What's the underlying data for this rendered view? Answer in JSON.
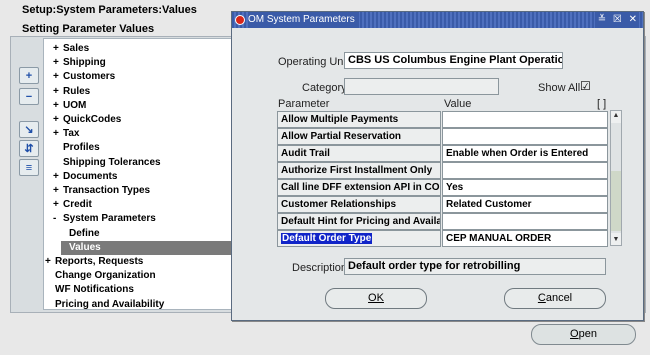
{
  "background": {
    "title": "Setup:System Parameters:Values",
    "subtitle": "Setting Parameter Values",
    "side_buttons": [
      "+",
      "−",
      "↘",
      "⇵",
      "≡"
    ],
    "tree": [
      {
        "pm": "+",
        "label": "Sales",
        "indent": 1
      },
      {
        "pm": "+",
        "label": "Shipping",
        "indent": 1
      },
      {
        "pm": "+",
        "label": "Customers",
        "indent": 1
      },
      {
        "pm": "+",
        "label": "Rules",
        "indent": 1
      },
      {
        "pm": "+",
        "label": "UOM",
        "indent": 1
      },
      {
        "pm": "+",
        "label": "QuickCodes",
        "indent": 1
      },
      {
        "pm": "+",
        "label": "Tax",
        "indent": 1
      },
      {
        "pm": "",
        "label": "Profiles",
        "indent": 1
      },
      {
        "pm": "",
        "label": "Shipping Tolerances",
        "indent": 1
      },
      {
        "pm": "+",
        "label": "Documents",
        "indent": 1
      },
      {
        "pm": "+",
        "label": "Transaction Types",
        "indent": 1
      },
      {
        "pm": "+",
        "label": "Credit",
        "indent": 1
      },
      {
        "pm": "-",
        "label": "System Parameters",
        "indent": 1
      },
      {
        "pm": "",
        "label": "Define",
        "indent": 2
      },
      {
        "pm": "",
        "label": "Values",
        "indent": 2,
        "selected": true
      },
      {
        "pm": "+",
        "label": "Reports, Requests",
        "indent": 0
      },
      {
        "pm": "",
        "label": "Change Organization",
        "indent": 0
      },
      {
        "pm": "",
        "label": "WF Notifications",
        "indent": 0
      },
      {
        "pm": "",
        "label": "Pricing and Availability",
        "indent": 0
      }
    ],
    "open_label": "Open"
  },
  "dialog": {
    "title": "OM System Parameters",
    "window_controls": "≚ ☒ ✕",
    "operating_unit_label": "Operating Unit",
    "operating_unit_value": "CBS US Columbus Engine Plant Operations",
    "category_label": "Category",
    "category_value": "",
    "show_all_label": "Show All",
    "show_all_check": "☑",
    "col_parameter": "Parameter",
    "col_value": "Value",
    "col_flex": "[ ]",
    "rows": [
      {
        "param": "Allow Multiple Payments",
        "value": ""
      },
      {
        "param": "Allow Partial Reservation",
        "value": ""
      },
      {
        "param": "Audit Trail",
        "value": "Enable when Order is Entered"
      },
      {
        "param": "Authorize First Installment Only",
        "value": ""
      },
      {
        "param": "Call line DFF extension API in COPY",
        "value": "Yes"
      },
      {
        "param": "Customer Relationships",
        "value": "Related Customer"
      },
      {
        "param": "Default Hint for Pricing and Availabil",
        "value": ""
      },
      {
        "param": "Default Order Type",
        "value": "CEP MANUAL ORDER",
        "selected": true
      }
    ],
    "description_label": "Description",
    "description_value": "Default order type for retrobilling",
    "ok_label": "OK",
    "cancel_label": "Cancel"
  }
}
